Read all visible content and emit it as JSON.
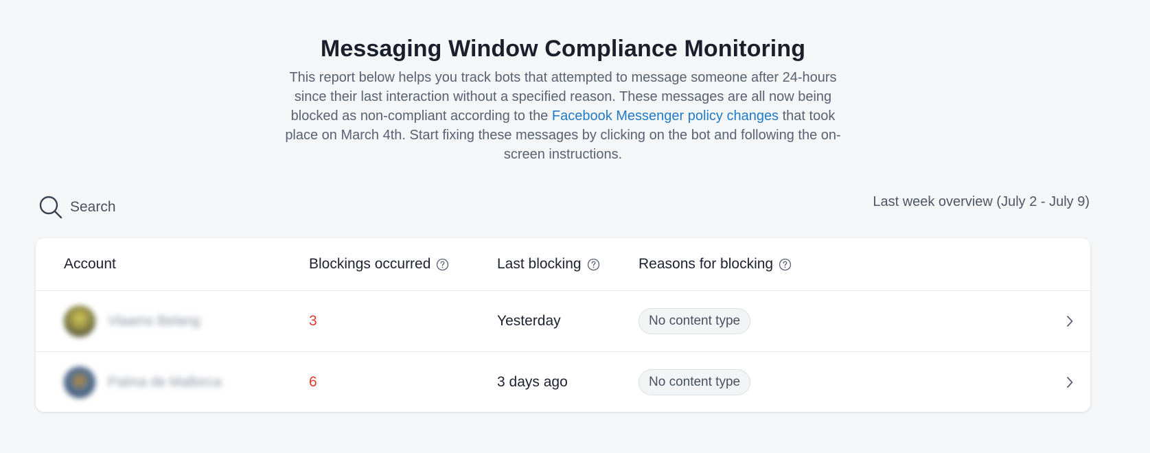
{
  "header": {
    "title": "Messaging Window Compliance Monitoring",
    "description_before_link": "This report below helps you track bots that attempted to message someone after 24-hours since their last interaction without a specified reason. These messages are all now being blocked as non-compliant according to the ",
    "link_text": "Facebook Messenger policy changes",
    "description_after_link": " that took place on March 4th. Start fixing these messages by clicking on the bot and following the on-screen instructions."
  },
  "toolbar": {
    "search_label": "Search",
    "search_icon": "search-icon",
    "overview_label": "Last week overview (July 2 - July 9)"
  },
  "table": {
    "columns": [
      {
        "label": "Account",
        "help": false
      },
      {
        "label": "Blockings occurred",
        "help": true
      },
      {
        "label": "Last blocking",
        "help": true
      },
      {
        "label": "Reasons for blocking",
        "help": true
      }
    ],
    "rows": [
      {
        "account": "Vlaams Belang",
        "blockings": "3",
        "last_blocking": "Yesterday",
        "reason": "No content type"
      },
      {
        "account": "Palma de Mallorca",
        "blockings": "6",
        "last_blocking": "3 days ago",
        "reason": "No content type"
      }
    ]
  },
  "colors": {
    "background": "#f5f6f8",
    "link": "#1f7ac7",
    "count_red": "#e0392e",
    "badge_bg": "#f3f4f6"
  }
}
